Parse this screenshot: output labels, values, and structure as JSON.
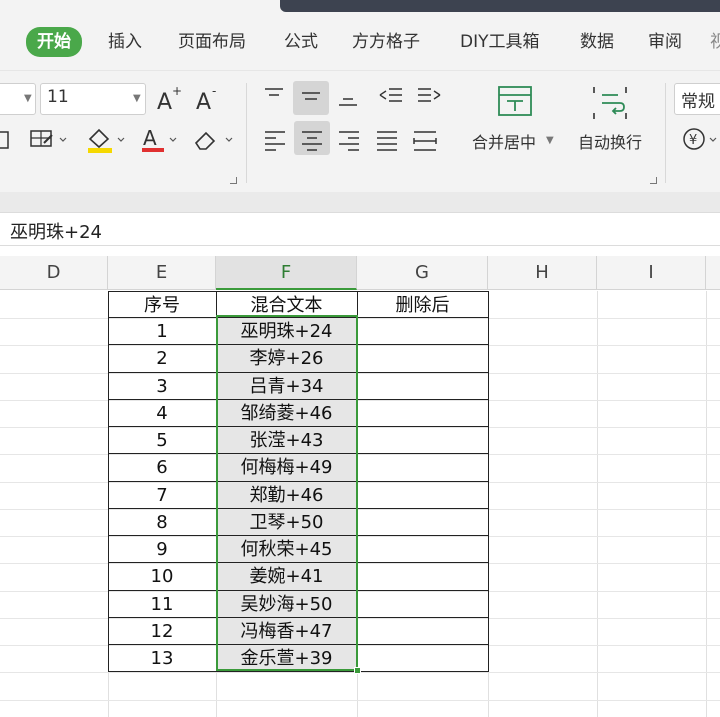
{
  "tabs": [
    {
      "label": "开始",
      "active": true
    },
    {
      "label": "插入"
    },
    {
      "label": "页面布局"
    },
    {
      "label": "公式"
    },
    {
      "label": "方方格子"
    },
    {
      "label": "DIY工具箱"
    },
    {
      "label": "数据"
    },
    {
      "label": "审阅"
    }
  ],
  "ribbon": {
    "font_size": "11",
    "merge_center_label": "合并居中",
    "wrap_text_label": "自动换行",
    "number_format": "常规",
    "icons": [
      "increase-font-icon",
      "decrease-font-icon",
      "border-icon",
      "fill-color-icon",
      "font-color-icon",
      "eraser-icon",
      "align-top-icon",
      "align-middle-icon",
      "align-bottom-icon",
      "indent-decrease-icon",
      "indent-increase-icon",
      "align-left-icon",
      "align-center-icon",
      "align-right-icon",
      "justify-icon",
      "distributed-icon",
      "currency-icon"
    ],
    "accent_fill": "#f5d800",
    "accent_font": "#e03030"
  },
  "formula_bar": {
    "content": "巫明珠+24"
  },
  "columns": [
    "D",
    "E",
    "F",
    "G",
    "H",
    "I"
  ],
  "selected_column": "F",
  "table": {
    "headers": [
      "序号",
      "混合文本",
      "删除后"
    ],
    "rows": [
      {
        "idx": "1",
        "text": "巫明珠+24",
        "result": ""
      },
      {
        "idx": "2",
        "text": "李婷+26",
        "result": ""
      },
      {
        "idx": "3",
        "text": "吕青+34",
        "result": ""
      },
      {
        "idx": "4",
        "text": "邹绮菱+46",
        "result": ""
      },
      {
        "idx": "5",
        "text": "张滢+43",
        "result": ""
      },
      {
        "idx": "6",
        "text": "何梅梅+49",
        "result": ""
      },
      {
        "idx": "7",
        "text": "郑勤+46",
        "result": ""
      },
      {
        "idx": "8",
        "text": "卫琴+50",
        "result": ""
      },
      {
        "idx": "9",
        "text": "何秋荣+45",
        "result": ""
      },
      {
        "idx": "10",
        "text": "姜婉+41",
        "result": ""
      },
      {
        "idx": "11",
        "text": "吴妙海+50",
        "result": ""
      },
      {
        "idx": "12",
        "text": "冯梅香+47",
        "result": ""
      },
      {
        "idx": "13",
        "text": "金乐萱+39",
        "result": ""
      }
    ]
  },
  "colors": {
    "accent_green": "#3a9a3a",
    "tab_active": "#4aa84a"
  }
}
